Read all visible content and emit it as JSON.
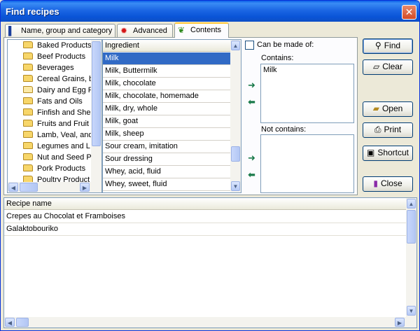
{
  "window": {
    "title": "Find recipes",
    "close_glyph": "✕"
  },
  "tabs": [
    {
      "label": "Name, group and category",
      "icon": "book-icon"
    },
    {
      "label": "Advanced",
      "icon": "splat-icon"
    },
    {
      "label": "Contents",
      "icon": "herb-icon"
    }
  ],
  "tree": {
    "items": [
      "Baked Products",
      "Beef Products",
      "Beverages",
      "Cereal Grains, b",
      "Dairy and Egg P",
      "Fats and Oils",
      "Finfish and She",
      "Fruits and Fruit J",
      "Lamb, Veal, and",
      "Legumes and L",
      "Nut and Seed P",
      "Pork Products",
      "Poultry Product"
    ]
  },
  "ingredients": {
    "header": "Ingredient",
    "rows": [
      "Milk",
      "Milk, Buttermilk",
      "Milk, chocolate",
      "Milk, chocolate, homemade",
      "Milk, dry, whole",
      "Milk, goat",
      "Milk, sheep",
      "Sour cream, imitation",
      "Sour dressing",
      "Whey, acid, fluid",
      "Whey, sweet, fluid"
    ],
    "selected": "Milk"
  },
  "contents": {
    "can_be_made_of_label": "Can be made of:",
    "contains_label": "Contains:",
    "contains_items": [
      "Milk"
    ],
    "not_contains_label": "Not contains:"
  },
  "buttons": {
    "find": "Find",
    "clear": "Clear",
    "open": "Open",
    "print": "Print",
    "shortcut": "Shortcut",
    "close": "Close"
  },
  "results": {
    "header": "Recipe name",
    "rows": [
      "Crepes au Chocolat et Framboises",
      "Galaktobouriko"
    ]
  },
  "colors": {
    "selection": "#316ac5",
    "titlebar": "#0a55d8",
    "arrow": "#1a7a4a"
  }
}
